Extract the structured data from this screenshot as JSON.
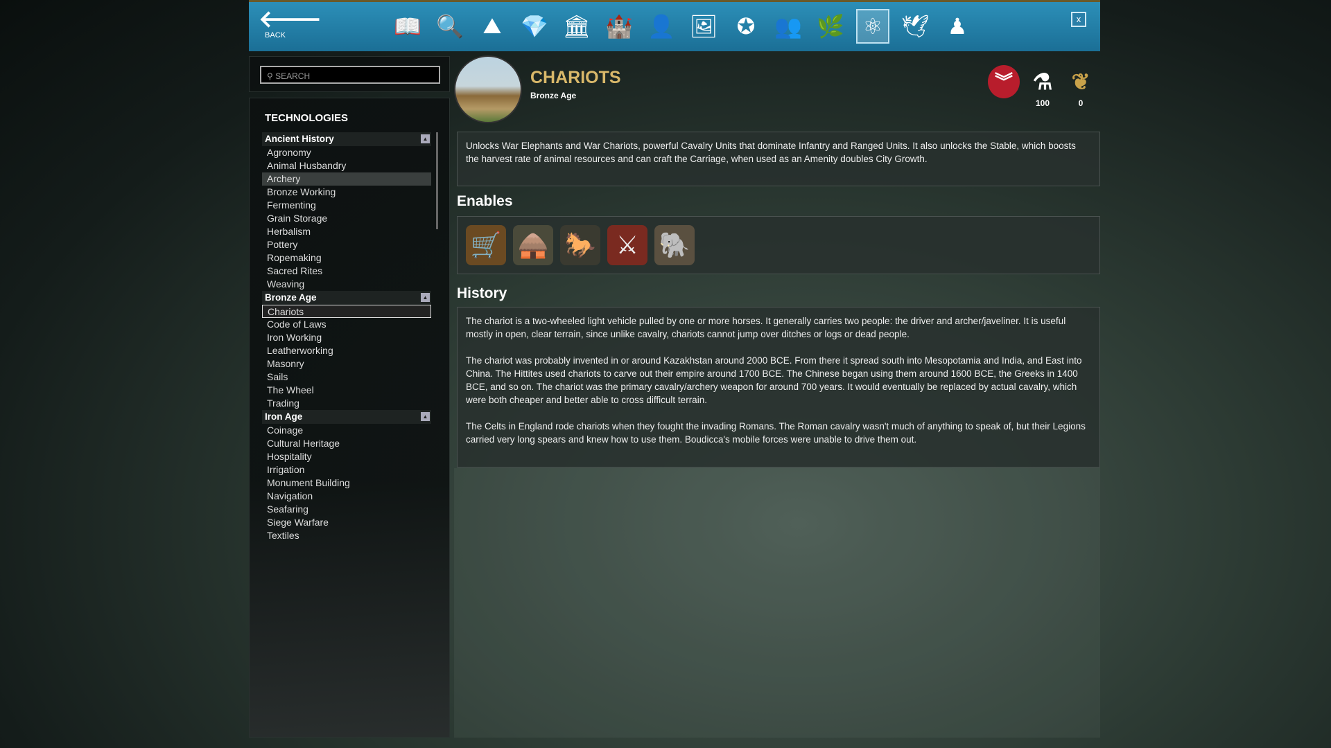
{
  "topbar": {
    "back_label": "BACK",
    "close_label": "x",
    "icons": [
      "book-icon",
      "magnifier-icon",
      "mountain-icon",
      "gem-icon",
      "government-building-icon",
      "castle-icon",
      "leader-icon",
      "painting-icon",
      "star-icon",
      "people-icon",
      "plants-icon",
      "atom-icon",
      "dove-icon",
      "pawn-icon"
    ],
    "glyphs": [
      "📖",
      "🔍",
      "⛰",
      "💎",
      "🏛",
      "🏰",
      "👤",
      "🖼",
      "✪",
      "👥",
      "🌿",
      "⚛",
      "🕊",
      "♟"
    ],
    "active_index": 11
  },
  "search": {
    "placeholder": "SEARCH"
  },
  "technologies": {
    "title": "TECHNOLOGIES",
    "categories": [
      {
        "name": "Ancient History",
        "items": [
          "Agronomy",
          "Animal Husbandry",
          "Archery",
          "Bronze Working",
          "Fermenting",
          "Grain Storage",
          "Herbalism",
          "Pottery",
          "Ropemaking",
          "Sacred Rites",
          "Weaving"
        ]
      },
      {
        "name": "Bronze Age",
        "items": [
          "Chariots",
          "Code of Laws",
          "Iron Working",
          "Leatherworking",
          "Masonry",
          "Sails",
          "The Wheel",
          "Trading"
        ]
      },
      {
        "name": "Iron Age",
        "items": [
          "Coinage",
          "Cultural Heritage",
          "Hospitality",
          "Irrigation",
          "Monument Building",
          "Navigation",
          "Seafaring",
          "Siege Warfare",
          "Textiles"
        ]
      }
    ],
    "selected": "Chariots",
    "hovered": "Archery"
  },
  "detail": {
    "title": "CHARIOTS",
    "era": "Bronze Age",
    "cost": "100",
    "upkeep": "0",
    "description": "Unlocks War Elephants and War Chariots, powerful Cavalry Units that dominate Infantry and Ranged Units. It also unlocks the Stable, which boosts the harvest rate of animal resources and can craft the Carriage, when used as an Amenity doubles City Growth.",
    "enables_heading": "Enables",
    "enables": [
      {
        "icon": "carriage-icon",
        "glyph": "🛒"
      },
      {
        "icon": "stable-icon",
        "glyph": "🛖"
      },
      {
        "icon": "horse-icon",
        "glyph": "🐎"
      },
      {
        "icon": "war-chariot-icon",
        "glyph": "⚔"
      },
      {
        "icon": "war-elephant-icon",
        "glyph": "🐘"
      }
    ],
    "history_heading": "History",
    "history": [
      "The chariot is a two-wheeled light vehicle pulled by one or more horses. It generally carries two people: the driver and archer/javeliner. It is useful mostly in open, clear terrain, since unlike cavalry, chariots cannot jump over ditches or logs or dead people.",
      "The chariot was probably invented in or around Kazakhstan around 2000 BCE. From there it spread south into Mesopotamia and India, and East into China. The Hittites used chariots to carve out their empire around 1700 BCE. The Chinese began using them around 1600 BCE, the Greeks in 1400 BCE, and so on. The chariot was the primary cavalry/archery weapon for around 700 years. It would eventually be replaced by actual cavalry, which were both cheaper and better able to cross difficult terrain.",
      "The Celts in England rode chariots when they fought the invading Romans. The Roman cavalry wasn't much of anything to speak of, but their Legions carried very long spears and knew how to use them. Boudicca's mobile forces were unable to drive them out."
    ]
  },
  "colors": {
    "accent_blue": "#1f7ea8",
    "title_gold": "#d9b86a",
    "military_red": "#b81d2c"
  }
}
